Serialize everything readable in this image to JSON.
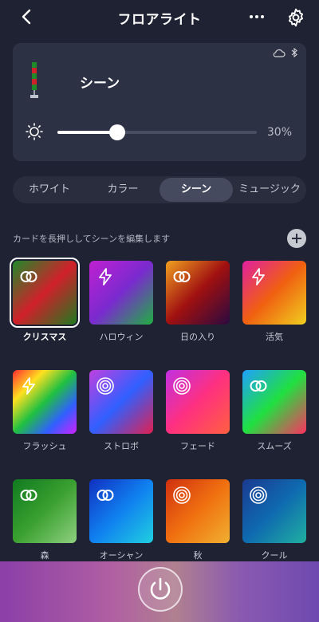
{
  "header": {
    "title": "フロアライト",
    "back_icon": "chevron-left-icon",
    "more_icon": "more-horizontal-icon",
    "settings_icon": "gear-icon"
  },
  "device": {
    "scene_label": "シーン",
    "brightness_text": "30%",
    "brightness_level": 0.3,
    "status_icons": [
      "cloud-icon",
      "bluetooth-icon"
    ]
  },
  "tabs": [
    {
      "label": "ホワイト",
      "active": false
    },
    {
      "label": "カラー",
      "active": false
    },
    {
      "label": "シーン",
      "active": true
    },
    {
      "label": "ミュージック",
      "active": false
    }
  ],
  "hint": "カードを長押ししてシーンを編集します",
  "scenes": [
    {
      "label": "クリスマス",
      "icon": "rings-icon",
      "selected": true,
      "gradient": [
        "#1f8a2a",
        "#d0202a",
        "#1e7a20"
      ]
    },
    {
      "label": "ハロウィン",
      "icon": "lightning-icon",
      "selected": false,
      "gradient": [
        "#c020d0",
        "#7a2ad0",
        "#1fb040"
      ]
    },
    {
      "label": "日の入り",
      "icon": "rings-icon",
      "selected": false,
      "gradient": [
        "#f0a020",
        "#a01010",
        "#2a0a40"
      ]
    },
    {
      "label": "活気",
      "icon": "lightning-icon",
      "selected": false,
      "gradient": [
        "#e020a0",
        "#f06010",
        "#f0d020"
      ]
    },
    {
      "label": "フラッシュ",
      "icon": "lightning-icon",
      "selected": false,
      "gradient": [
        "#ff2a30",
        "#ffe020",
        "#20c040",
        "#3060ff",
        "#d020ff"
      ]
    },
    {
      "label": "ストロボ",
      "icon": "concentric-circle-icon",
      "selected": false,
      "gradient": [
        "#c040e0",
        "#3060ff",
        "#e02050"
      ]
    },
    {
      "label": "フェード",
      "icon": "concentric-circle-icon",
      "selected": false,
      "gradient": [
        "#c030e0",
        "#ff3080",
        "#ff6040"
      ]
    },
    {
      "label": "スムーズ",
      "icon": "rings-icon",
      "selected": false,
      "gradient": [
        "#20a0ff",
        "#20e040",
        "#ff3060"
      ]
    },
    {
      "label": "森",
      "icon": "rings-icon",
      "selected": false,
      "gradient": [
        "#107a20",
        "#3aa030",
        "#90d080"
      ]
    },
    {
      "label": "オーシャン",
      "icon": "rings-icon",
      "selected": false,
      "gradient": [
        "#1030c0",
        "#1080f0",
        "#20d0e0"
      ]
    },
    {
      "label": "秋",
      "icon": "concentric-circle-icon",
      "selected": false,
      "gradient": [
        "#d03010",
        "#f07010",
        "#f0b030"
      ]
    },
    {
      "label": "クール",
      "icon": "concentric-circle-icon",
      "selected": false,
      "gradient": [
        "#1a3a90",
        "#0f6ab0",
        "#20b0a0"
      ]
    }
  ],
  "power_icon": "power-icon"
}
